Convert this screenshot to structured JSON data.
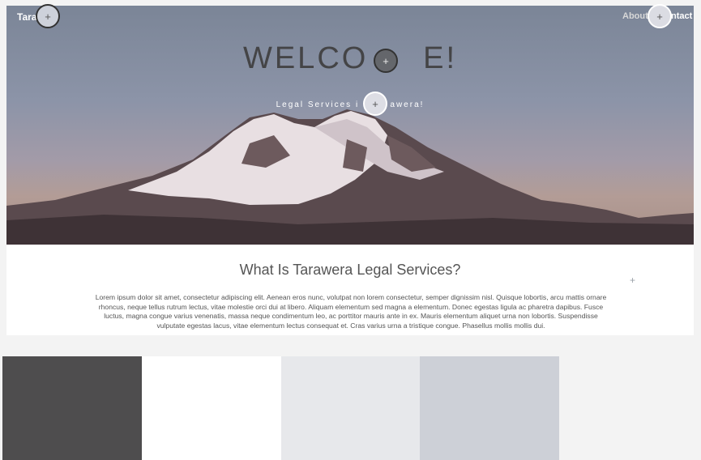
{
  "nav": {
    "brand": "Tara",
    "about": "About",
    "contact": "ntact"
  },
  "hero": {
    "title": "WELCO     E!",
    "tagline": "Legal Services i        awera!"
  },
  "section": {
    "title": "What Is Tarawera Legal Services?",
    "body": "Lorem ipsum dolor sit amet, consectetur adipiscing elit. Aenean eros nunc, volutpat non lorem consectetur, semper dignissim nisl. Quisque lobortis, arcu mattis ornare rhoncus, neque tellus rutrum lectus, vitae molestie orci dui at libero. Aliquam elementum sed magna a elementum. Donec egestas ligula ac pharetra dapibus. Fusce luctus, magna congue varius venenatis, massa neque condimentum leo, ac porttitor mauris ante in ex. Mauris elementum aliquet urna non lobortis. Suspendisse vulputate egestas lacus, vitae elementum lectus consequat et. Cras varius urna a tristique congue. Phasellus mollis mollis dui."
  },
  "markers": {
    "plus": "+"
  },
  "palette": [
    "#4e4d4e",
    "#ffffff",
    "#e7e8eb",
    "#cdd0d7",
    "#f3f3f3"
  ]
}
